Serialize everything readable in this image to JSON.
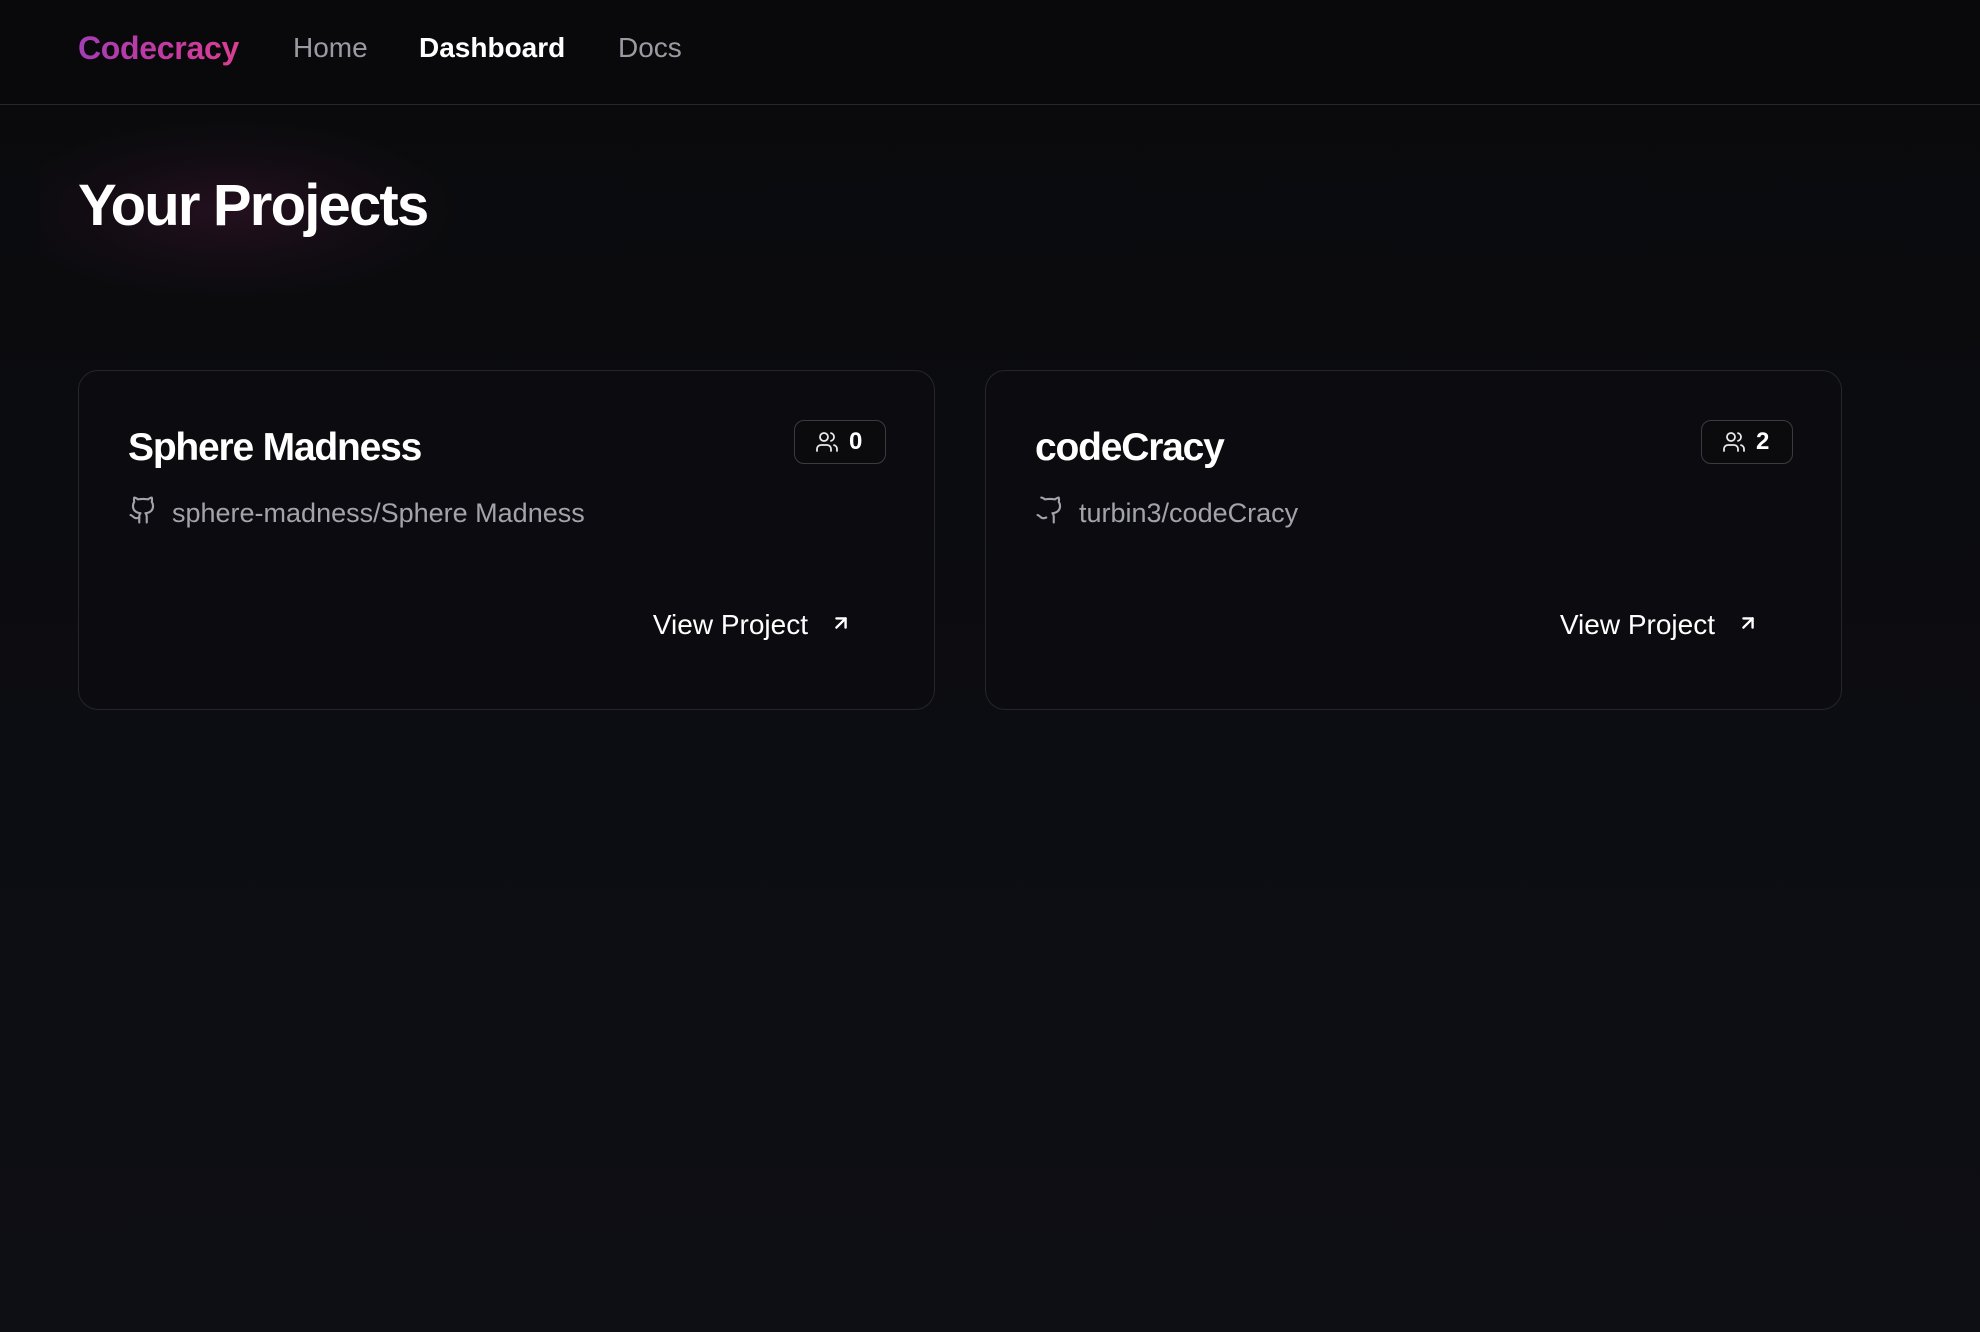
{
  "nav": {
    "brand": "Codecracy",
    "links": [
      {
        "label": "Home",
        "active": false
      },
      {
        "label": "Dashboard",
        "active": true
      },
      {
        "label": "Docs",
        "active": false
      }
    ]
  },
  "page": {
    "title": "Your Projects"
  },
  "projects": [
    {
      "name": "Sphere Madness",
      "members": "0",
      "repo": "sphere-madness/Sphere Madness",
      "action_label": "View Project"
    },
    {
      "name": "codeCracy",
      "members": "2",
      "repo": "turbin3/codeCracy",
      "action_label": "View Project"
    }
  ],
  "icons": {
    "members": "users-icon",
    "repo": "github-icon",
    "action": "arrow-up-right-icon"
  },
  "colors": {
    "brand_gradient_start": "#a43db4",
    "brand_gradient_end": "#d93f92",
    "background": "#0c0d12",
    "card_border": "#25262c"
  }
}
